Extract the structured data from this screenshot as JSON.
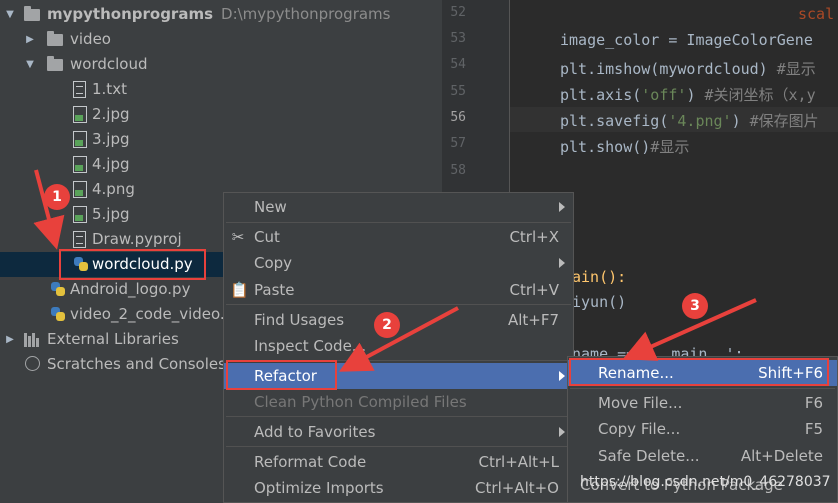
{
  "tree": {
    "project_name": "mypythonprograms",
    "project_path": "D:\\mypythonprograms",
    "items": [
      {
        "label": "video"
      },
      {
        "label": "wordcloud"
      },
      {
        "label": "1.txt"
      },
      {
        "label": "2.jpg"
      },
      {
        "label": "3.jpg"
      },
      {
        "label": "4.jpg"
      },
      {
        "label": "4.png"
      },
      {
        "label": "5.jpg"
      },
      {
        "label": "Draw.pyproj"
      },
      {
        "label": "wordcloud.py"
      },
      {
        "label": "Android_logo.py"
      },
      {
        "label": "video_2_code_video."
      },
      {
        "label": "External Libraries"
      },
      {
        "label": "Scratches and Consoles"
      }
    ]
  },
  "editor": {
    "line_numbers": [
      "52",
      "53",
      "54",
      "55",
      "56",
      "57",
      "58"
    ],
    "lines": [
      {
        "text": "scal"
      },
      {
        "text": "image_color = ImageColorGene"
      },
      {
        "code": "plt.imshow(mywordcloud) ",
        "comment": "#显示"
      },
      {
        "code": "plt.axis(",
        "string": "'off'",
        "code2": ") ",
        "comment": "#关闭坐标（x,y"
      },
      {
        "code": "plt.savefig(",
        "string": "'4.png'",
        "code2": ") ",
        "comment": "#保存图片"
      },
      {
        "code": "plt.show()",
        "comment": "#显示"
      }
    ],
    "fragments": {
      "main_def": "ain():",
      "call": "iyun()",
      "name_check": "name  == '__main__':"
    }
  },
  "context_menu": {
    "items": [
      {
        "label": "New",
        "shortcut": "",
        "submenu": true
      },
      {
        "label": "Cut",
        "shortcut": "Ctrl+X",
        "icon": "scissors-icon"
      },
      {
        "label": "Copy",
        "shortcut": "",
        "submenu": true
      },
      {
        "label": "Paste",
        "shortcut": "Ctrl+V",
        "icon": "clipboard-icon"
      },
      {
        "label": "Find Usages",
        "shortcut": "Alt+F7"
      },
      {
        "label": "Inspect Code...",
        "shortcut": ""
      },
      {
        "label": "Refactor",
        "shortcut": "",
        "submenu": true,
        "highlighted": true
      },
      {
        "label": "Clean Python Compiled Files",
        "shortcut": "",
        "disabled": true
      },
      {
        "label": "Add to Favorites",
        "shortcut": "",
        "submenu": true
      },
      {
        "label": "Reformat Code",
        "shortcut": "Ctrl+Alt+L"
      },
      {
        "label": "Optimize Imports",
        "shortcut": "Ctrl+Alt+O"
      }
    ]
  },
  "refactor_submenu": {
    "items": [
      {
        "label": "Rename...",
        "shortcut": "Shift+F6",
        "highlighted": true
      },
      {
        "label": "Move File...",
        "shortcut": "F6"
      },
      {
        "label": "Copy File...",
        "shortcut": "F5"
      },
      {
        "label": "Safe Delete...",
        "shortcut": "Alt+Delete"
      },
      {
        "label": "Convert to Python Package",
        "shortcut": ""
      }
    ]
  },
  "annotations": {
    "badges": [
      "1",
      "2",
      "3"
    ],
    "color": "#e8413c"
  },
  "watermark": "https://blog.csdn.net/m0_46278037",
  "colors": {
    "tree_bg": "#3c3f41",
    "editor_bg": "#2b2b2b",
    "selection": "#0d293e",
    "menu_highlight": "#4b6eaf"
  }
}
